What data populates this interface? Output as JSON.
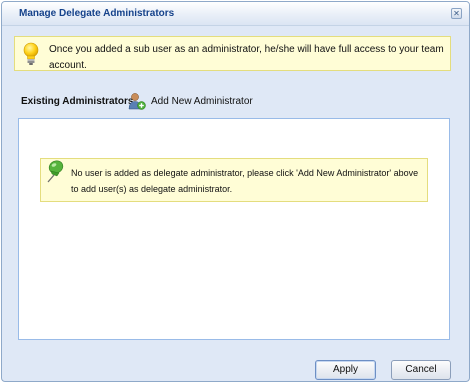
{
  "dialog": {
    "title": "Manage Delegate Administrators",
    "close_glyph": "✕",
    "close_icon": "close-icon"
  },
  "info": {
    "icon": "lightbulb-icon",
    "text": "Once you added a sub user as an administrator, he/she will have full access to your team account."
  },
  "section": {
    "label": "Existing Administrators",
    "add_icon": "add-user-icon",
    "add_label": "Add New Administrator"
  },
  "list": {
    "notice_icon": "pin-icon",
    "notice_text": "No user is added as delegate administrator, please click 'Add New Administrator' above to add user(s) as delegate administrator."
  },
  "buttons": {
    "apply_label": "Apply",
    "cancel_label": "Cancel"
  },
  "colors": {
    "title_text": "#15428b",
    "dialog_bg": "#dfe8f6",
    "info_bg": "#fffdd6",
    "panel_border": "#99bbe8"
  }
}
